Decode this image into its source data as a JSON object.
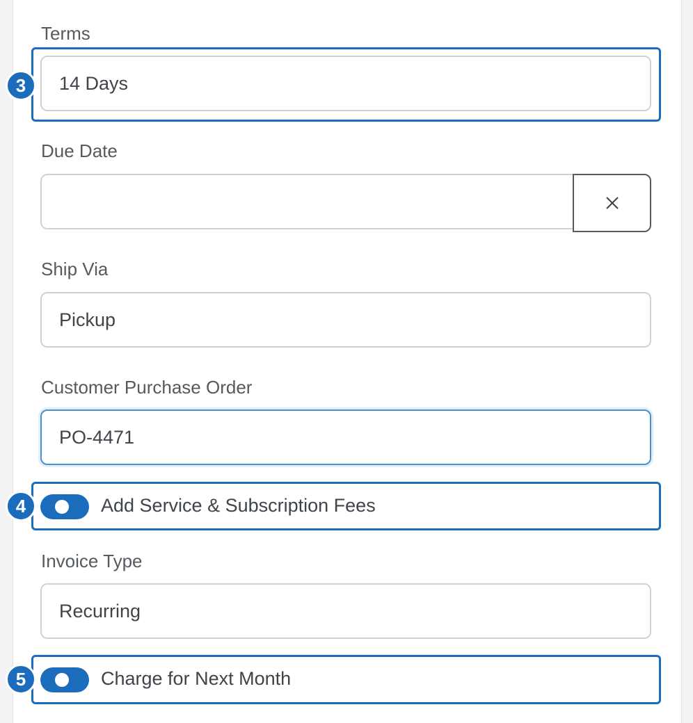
{
  "fields": {
    "terms": {
      "label": "Terms",
      "value": "14 Days"
    },
    "due_date": {
      "label": "Due Date",
      "value": ""
    },
    "ship_via": {
      "label": "Ship Via",
      "value": "Pickup"
    },
    "customer_po": {
      "label": "Customer Purchase Order",
      "value": "PO-4471"
    },
    "invoice_type": {
      "label": "Invoice Type",
      "value": "Recurring"
    }
  },
  "toggles": {
    "service_fees": {
      "label": "Add Service & Subscription Fees",
      "on": true
    },
    "next_month": {
      "label": "Charge for Next Month",
      "on": true
    }
  },
  "markers": {
    "terms": "3",
    "service_fees": "4",
    "next_month": "5"
  },
  "icons": {
    "clear": "close-icon"
  },
  "colors": {
    "accent": "#1b6dbb",
    "focus_border": "#4d8fc9",
    "label": "#555a5f",
    "text": "#3f444a"
  }
}
